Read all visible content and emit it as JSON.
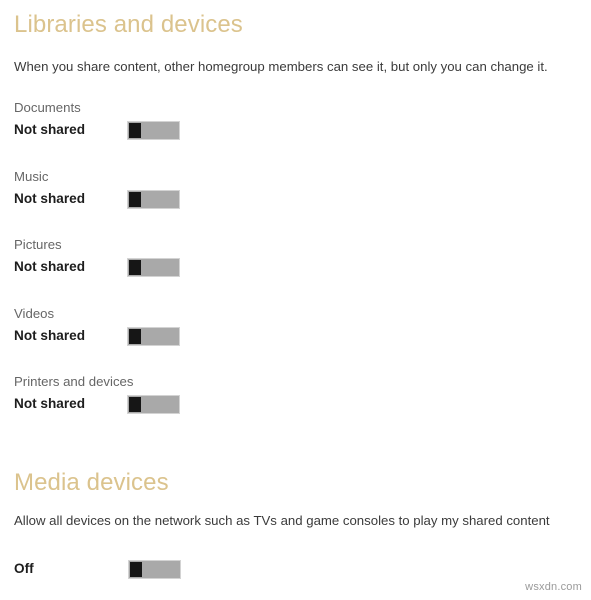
{
  "colors": {
    "heading": "#dbc38d",
    "body_text": "#3b3b3b",
    "row_label": "#666666",
    "row_state": "#1d1d1d",
    "toggle_track": "#a9a9a9",
    "toggle_knob": "#161616",
    "toggle_border": "#d3d3d3",
    "background": "#ffffff",
    "watermark": "#9a9a9a"
  },
  "libraries_section": {
    "heading": "Libraries and devices",
    "description": "When you share content, other homegroup members can see it, but only you can change it.",
    "rows": [
      {
        "label": "Documents",
        "state": "Not shared",
        "toggle": "off"
      },
      {
        "label": "Music",
        "state": "Not shared",
        "toggle": "off"
      },
      {
        "label": "Pictures",
        "state": "Not shared",
        "toggle": "off"
      },
      {
        "label": "Videos",
        "state": "Not shared",
        "toggle": "off"
      },
      {
        "label": "Printers and devices",
        "state": "Not shared",
        "toggle": "off"
      }
    ]
  },
  "media_section": {
    "heading": "Media devices",
    "description": "Allow all devices on the network such as TVs and game consoles to play my shared content",
    "state": "Off",
    "toggle": "off"
  },
  "watermark": "wsxdn.com"
}
